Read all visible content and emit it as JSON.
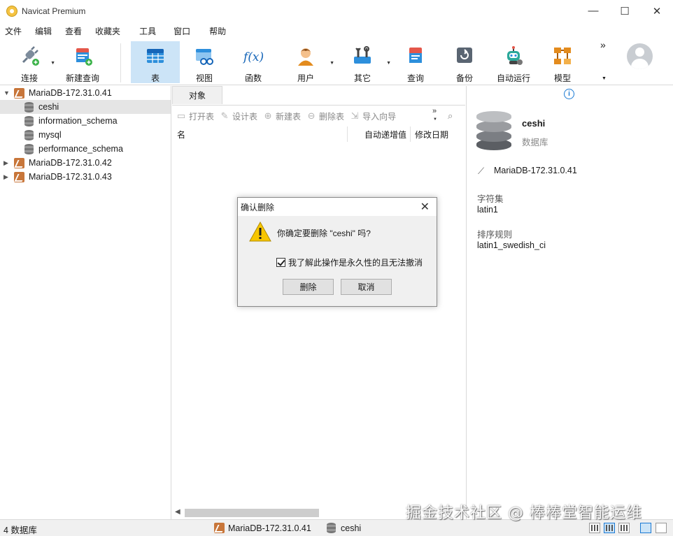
{
  "window": {
    "title": "Navicat Premium",
    "controls": [
      "—",
      "☐",
      "✕"
    ]
  },
  "menu": [
    "文件",
    "编辑",
    "查看",
    "收藏夹",
    "工具",
    "窗口",
    "帮助"
  ],
  "toolbar": {
    "buttons": [
      {
        "label": "连接",
        "icon": "plug-icon"
      },
      {
        "label": "新建查询",
        "icon": "new-query-icon"
      },
      {
        "label": "表",
        "icon": "table-icon",
        "active": true
      },
      {
        "label": "视图",
        "icon": "view-icon"
      },
      {
        "label": "函数",
        "icon": "function-icon",
        "glyph": "f(x)"
      },
      {
        "label": "用户",
        "icon": "user-icon"
      },
      {
        "label": "其它",
        "icon": "tools-icon"
      },
      {
        "label": "查询",
        "icon": "query-icon"
      },
      {
        "label": "备份",
        "icon": "backup-icon"
      },
      {
        "label": "自动运行",
        "icon": "robot-icon"
      },
      {
        "label": "模型",
        "icon": "model-icon"
      }
    ],
    "more": "»"
  },
  "tree": {
    "items": [
      {
        "label": "MariaDB-172.31.0.41",
        "type": "server",
        "expanded": true
      },
      {
        "label": "ceshi",
        "type": "database",
        "selected": true
      },
      {
        "label": "information_schema",
        "type": "database"
      },
      {
        "label": "mysql",
        "type": "database"
      },
      {
        "label": "performance_schema",
        "type": "database"
      },
      {
        "label": "MariaDB-172.31.0.42",
        "type": "server",
        "expanded": false
      },
      {
        "label": "MariaDB-172.31.0.43",
        "type": "server",
        "expanded": false
      }
    ]
  },
  "objects": {
    "tab": "对象",
    "actions": [
      "打开表",
      "设计表",
      "新建表",
      "删除表",
      "导入向导"
    ],
    "columns": [
      "名",
      "自动递增值",
      "修改日期"
    ]
  },
  "info": {
    "db_name": "ceshi",
    "db_type": "数据库",
    "connection": "MariaDB-172.31.0.41",
    "charset_label": "字符集",
    "charset_value": "latin1",
    "collation_label": "排序规则",
    "collation_value": "latin1_swedish_ci"
  },
  "dialog": {
    "title": "确认删除",
    "message": "你确定要删除 \"ceshi\" 吗?",
    "checkbox_label": "我了解此操作是永久性的且无法撤消",
    "checkbox_checked": true,
    "confirm_label": "删除",
    "cancel_label": "取消"
  },
  "status": {
    "count": "4 数据库",
    "connection": "MariaDB-172.31.0.41",
    "database": "ceshi"
  },
  "watermark": "掘金技术社区 @ 棒棒堂智能运维",
  "colors": {
    "accent": "#1a7ad4",
    "selection": "#cce4f7",
    "server_icon": "#c8763a",
    "warning": "#f7c600"
  }
}
